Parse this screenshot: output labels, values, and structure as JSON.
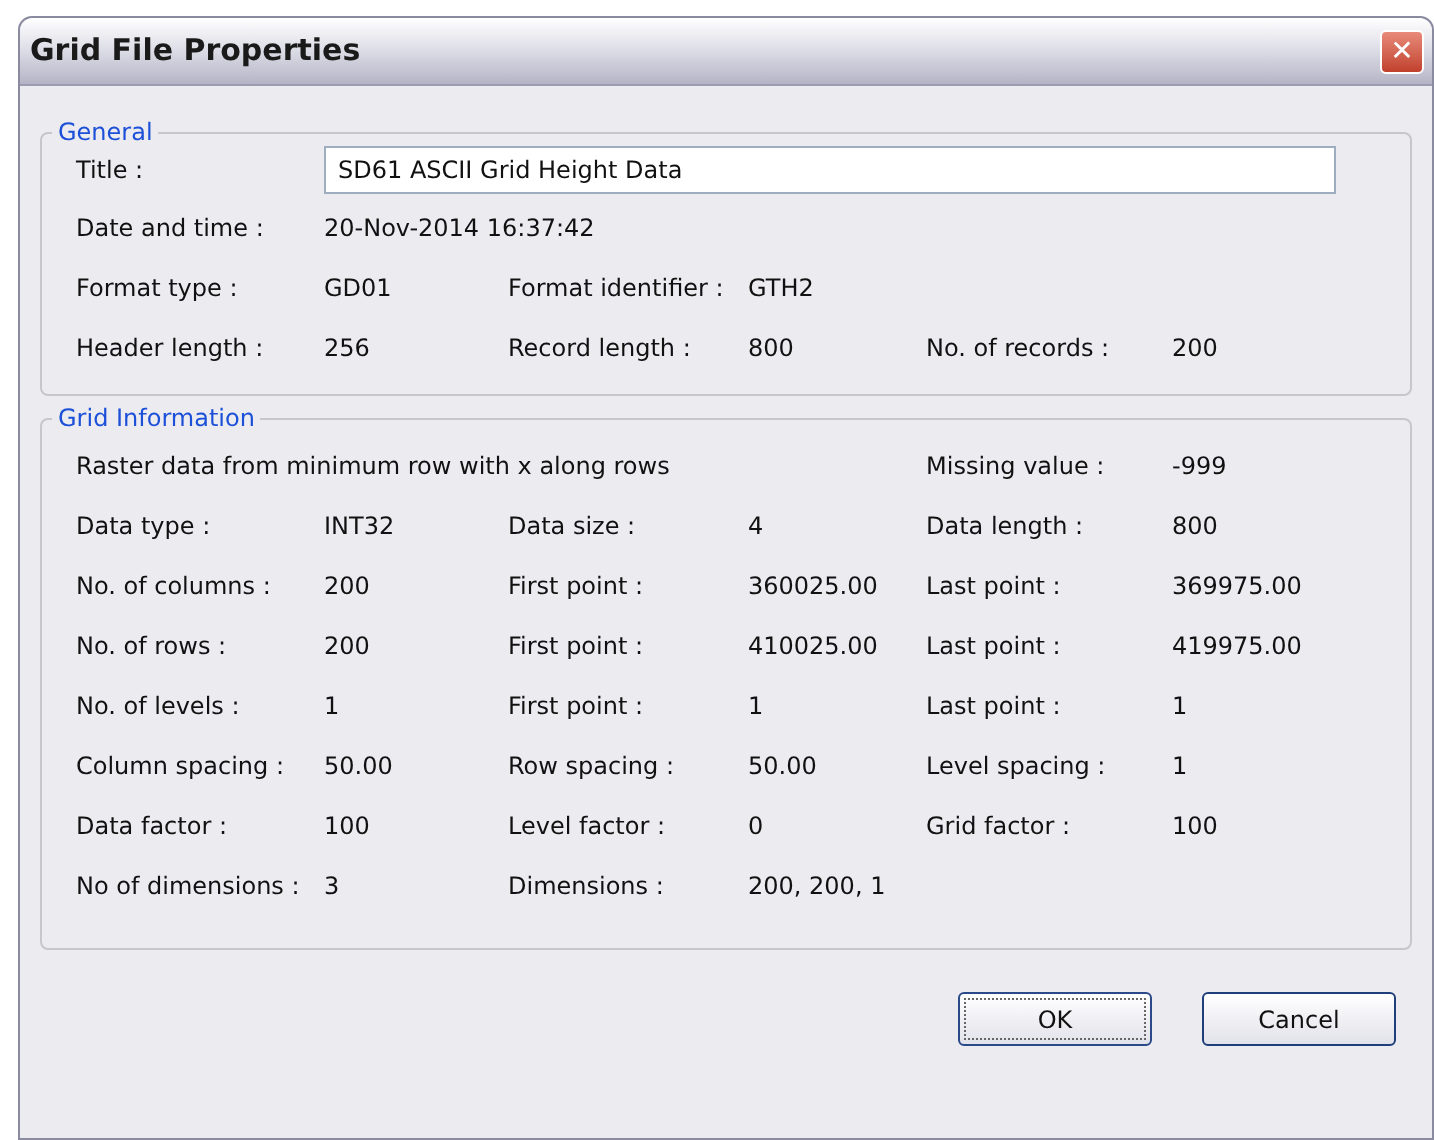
{
  "window": {
    "title": "Grid File Properties",
    "close": "✕"
  },
  "general": {
    "legend": "General",
    "title_field": {
      "label": "Title :",
      "value": "SD61 ASCII Grid Height Data"
    },
    "rows": [
      [
        {
          "kind": "field",
          "label": "Date and time :",
          "value": "20-Nov-2014 16:37:42"
        }
      ],
      [
        {
          "kind": "field",
          "label": "Format type :",
          "value": "GD01"
        },
        {
          "kind": "field",
          "label": "Format identifier :",
          "value": "GTH2"
        }
      ],
      [
        {
          "kind": "field",
          "label": "Header length :",
          "value": "256"
        },
        {
          "kind": "field",
          "label": "Record length :",
          "value": "800"
        },
        {
          "kind": "field",
          "label": "No. of records :",
          "value": "200"
        }
      ]
    ]
  },
  "grid_information": {
    "legend": "Grid Information",
    "summary": {
      "note": "Raster data from minimum row with x along rows",
      "missing_value": {
        "label": "Missing value :",
        "value": "-999"
      }
    },
    "rows": [
      [
        {
          "kind": "field",
          "label": "Data type :",
          "value": "INT32"
        },
        {
          "kind": "field",
          "label": "Data size :",
          "value": "4"
        },
        {
          "kind": "field",
          "label": "Data length :",
          "value": "800"
        }
      ],
      [
        {
          "kind": "field",
          "label": "No. of columns :",
          "value": "200"
        },
        {
          "kind": "field",
          "label": "First point :",
          "value": "360025.00"
        },
        {
          "kind": "field",
          "label": "Last point :",
          "value": "369975.00"
        }
      ],
      [
        {
          "kind": "field",
          "label": "No. of rows :",
          "value": "200"
        },
        {
          "kind": "field",
          "label": "First point :",
          "value": "410025.00"
        },
        {
          "kind": "field",
          "label": "Last point :",
          "value": "419975.00"
        }
      ],
      [
        {
          "kind": "field",
          "label": "No. of levels :",
          "value": "1"
        },
        {
          "kind": "field",
          "label": "First point :",
          "value": "1"
        },
        {
          "kind": "field",
          "label": "Last point :",
          "value": "1"
        }
      ],
      [
        {
          "kind": "field",
          "label": "Column spacing :",
          "value": "50.00"
        },
        {
          "kind": "field",
          "label": "Row spacing :",
          "value": "50.00"
        },
        {
          "kind": "field",
          "label": "Level spacing :",
          "value": "1"
        }
      ],
      [
        {
          "kind": "field",
          "label": "Data factor :",
          "value": "100"
        },
        {
          "kind": "field",
          "label": "Level factor :",
          "value": "0"
        },
        {
          "kind": "field",
          "label": "Grid factor :",
          "value": "100"
        }
      ],
      [
        {
          "kind": "field",
          "label": "No of dimensions :",
          "value": "3"
        },
        {
          "kind": "field",
          "label": "Dimensions :",
          "value": "200, 200, 1"
        }
      ]
    ]
  },
  "buttons": [
    {
      "label": "OK",
      "selected": true
    },
    {
      "label": "Cancel",
      "selected": false
    }
  ]
}
